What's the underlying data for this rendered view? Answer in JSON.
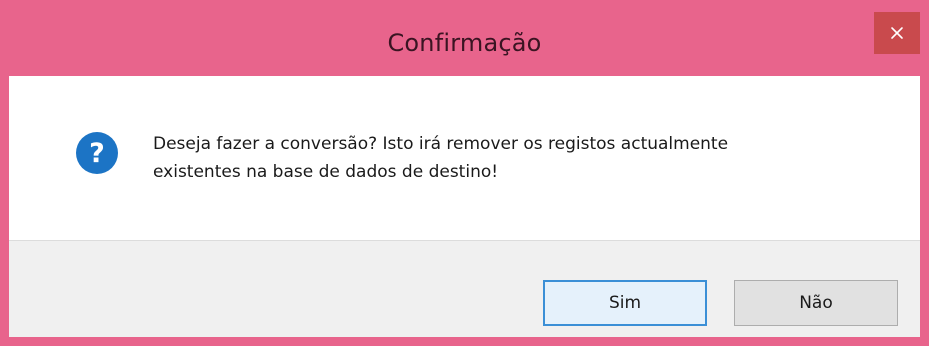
{
  "window": {
    "title": "Confirmação",
    "close_glyph": "×"
  },
  "dialog": {
    "icon": "question-icon",
    "message": "Deseja fazer a conversão? Isto irá remover os registos actualmente\nexistentes na base de dados de destino!"
  },
  "buttons": {
    "yes_label": "Sim",
    "no_label": "Não"
  },
  "colors": {
    "titlebar": "#e8648c",
    "close_button": "#c94a4d",
    "icon_blue": "#1c74c5",
    "default_button_border": "#3b8fd6"
  }
}
